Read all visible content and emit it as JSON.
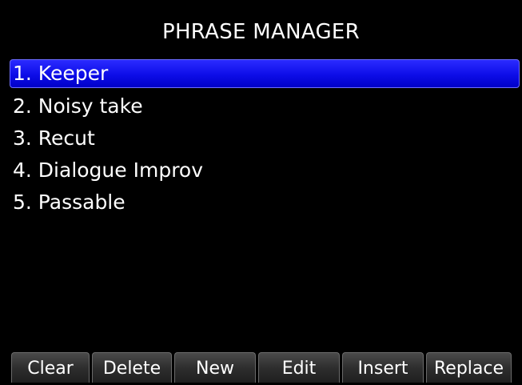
{
  "header": {
    "title": "PHRASE MANAGER"
  },
  "phrases": [
    {
      "label": "1. Keeper",
      "selected": true
    },
    {
      "label": "2. Noisy take",
      "selected": false
    },
    {
      "label": "3. Recut",
      "selected": false
    },
    {
      "label": "4. Dialogue Improv",
      "selected": false
    },
    {
      "label": "5. Passable",
      "selected": false
    }
  ],
  "softkeys": {
    "clear": "Clear",
    "delete": "Delete",
    "new": "New",
    "edit": "Edit",
    "insert": "Insert",
    "replace": "Replace"
  },
  "colors": {
    "background": "#000000",
    "selection": "#0d0de8",
    "text": "#ffffff",
    "softkey": "#2e2e2e"
  }
}
